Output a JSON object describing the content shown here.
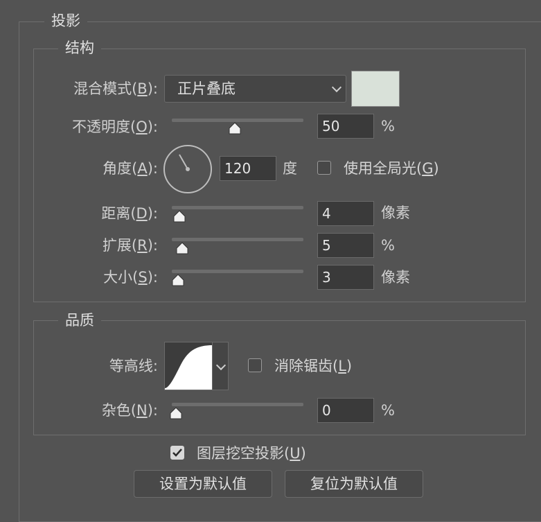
{
  "dialog": {
    "outer_title": "投影",
    "structure": {
      "title": "结构",
      "blend_mode": {
        "label": "混合模式",
        "hotkey": "B",
        "value": "正片叠底"
      },
      "swatch_color": "#d9e1d9",
      "opacity": {
        "label": "不透明度",
        "hotkey": "O",
        "value": "50",
        "unit": "%",
        "fraction": 0.5
      },
      "angle": {
        "label": "角度",
        "hotkey": "A",
        "value": "120",
        "unit": "度",
        "degrees": 120
      },
      "global_light": {
        "label": "使用全局光",
        "hotkey": "G",
        "checked": false
      },
      "distance": {
        "label": "距离",
        "hotkey": "D",
        "value": "4",
        "unit": "像素",
        "fraction": 0.03
      },
      "spread": {
        "label": "扩展",
        "hotkey": "R",
        "value": "5",
        "unit": "%",
        "fraction": 0.05
      },
      "size": {
        "label": "大小",
        "hotkey": "S",
        "value": "3",
        "unit": "像素",
        "fraction": 0.02
      }
    },
    "quality": {
      "title": "品质",
      "contour": {
        "label": "等高线:"
      },
      "anti_alias": {
        "label": "消除锯齿",
        "hotkey": "L",
        "checked": false
      },
      "noise": {
        "label": "杂色",
        "hotkey": "N",
        "value": "0",
        "unit": "%",
        "fraction": 0
      }
    },
    "knockout": {
      "label": "图层挖空投影",
      "hotkey": "U",
      "checked": true
    },
    "buttons": {
      "make_default": "设置为默认值",
      "reset_default": "复位为默认值"
    }
  }
}
